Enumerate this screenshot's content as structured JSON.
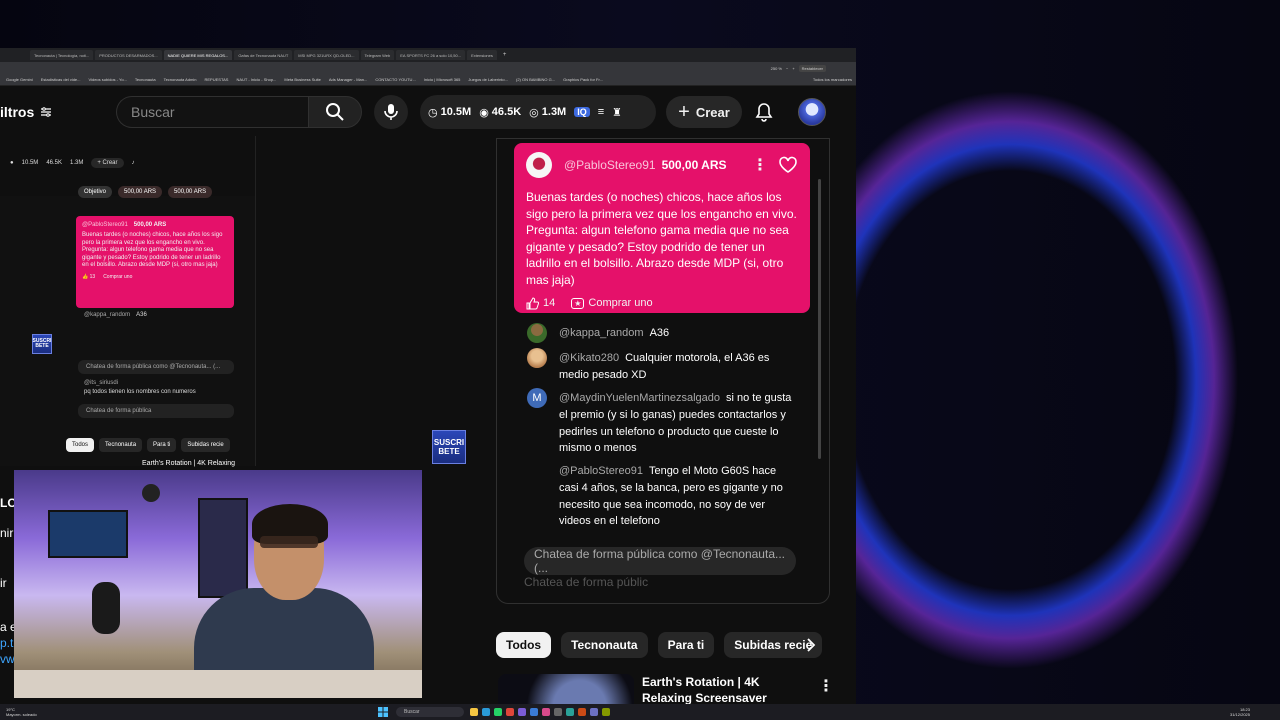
{
  "browser": {
    "tabs": [
      {
        "label": "Tecnonauta | Tecnología, noti..."
      },
      {
        "label": "PRODUCTOS DESARMADOS..."
      },
      {
        "label": "NADIE QUIERE MIS REGALOS..."
      },
      {
        "label": "Gafas de Tecnonauta NAUT"
      },
      {
        "label": "MSI MPG 321URX QD-OLED..."
      },
      {
        "label": "Telegram Web"
      },
      {
        "label": "EA SPORTS FC 26 a solo 10,50..."
      },
      {
        "label": "Extensiones"
      }
    ],
    "active_tab": 2,
    "zoom": "250 %",
    "restore_label": "Restablecer",
    "bookmarks": [
      "Google Gemini",
      "Estadísticas del vide...",
      "Videos subidos - Yo...",
      "Tecnonauta",
      "Tecnonauta Admin",
      "REPUESTAS",
      "NAUT - Inicio - Shop...",
      "Meta Business Suite",
      "Ads Manager - Man...",
      "CONTACTO YOUTU...",
      "Inicio | Microsoft 365",
      "Juegos de Laberinto...",
      "(2) ON BAMBINO G...",
      "Graphics Pack for Fr...",
      "Todos los marcadores"
    ]
  },
  "header": {
    "filters_label": "iltros",
    "search_placeholder": "Buscar",
    "stats": {
      "views": "10.5M",
      "watch": "46.5K",
      "subs": "1.3M"
    },
    "create_label": "Crear"
  },
  "mini": {
    "stats": {
      "views": "10.5M",
      "watch": "46.5K",
      "subs": "1.3M"
    },
    "create_label": "Crear",
    "chips": [
      "Objetivo",
      "500,00 ARS",
      "500,00 ARS"
    ],
    "super": {
      "user": "@PabloStereo91",
      "amount": "500,00 ARS",
      "text": "Buenas tardes (o noches) chicos, hace años los sigo pero la primera vez que los engancho en vivo. Pregunta: algun telefono gama media que no sea gigante y pesado? Estoy podrido de tener un ladrillo en el bolsillo. Abrazo desde MDP (si, otro mas jaja)",
      "likes": "13",
      "buy": "Comprar uno"
    },
    "reply_author": "@kappa_random",
    "reply_text": "A36",
    "input_placeholder": "Chatea de forma pública como @Tecnonauta... (...",
    "extra_author": "@its_siriusdi",
    "extra_text": "pq todos tienen los nombres con numeros",
    "input2_placeholder": "Chatea de forma pública",
    "tabs": [
      "Todos",
      "Tecnonauta",
      "Para ti",
      "Subidas recie"
    ],
    "video_title": "Earth's Rotation | 4K Relaxing"
  },
  "subscribe_badge": "SUSCRI BETE",
  "chat": {
    "super": {
      "user": "@PabloStereo91",
      "amount": "500,00 ARS",
      "text": "Buenas tardes (o noches) chicos, hace años los sigo pero la primera vez que los engancho en vivo. Pregunta: algun telefono gama media que no sea gigante y pesado? Estoy podrido de tener un ladrillo en el bolsillo. Abrazo desde MDP (si, otro mas jaja)",
      "likes": "14",
      "buy": "Comprar uno",
      "color": "#e5116a"
    },
    "messages": [
      {
        "author": "@kappa_random",
        "text": "A36"
      },
      {
        "author": "@Kikato280",
        "text": "Cualquier motorola, el A36 es medio pesado XD"
      },
      {
        "author": "@MaydinYuelenMartinezsalgado",
        "text": "si no te gusta el premio (y si lo ganas) puedes contactarlos y pedirles un telefono o producto que cueste lo mismo o menos",
        "initial": "M"
      },
      {
        "author": "@PabloStereo91",
        "text": "Tengo el Moto G60S hace casi 4 años, se la banca, pero es gigante y no necesito que sea incomodo, no soy de ver videos en el telefono"
      }
    ],
    "input_placeholder": "Chatea de forma pública como @Tecnonauta... (...",
    "ghost_text": "Chatea de forma públic"
  },
  "chips": [
    "Todos",
    "Tecnonauta",
    "Para ti",
    "Subidas recie"
  ],
  "video": {
    "title": "Earth's Rotation | 4K Relaxing Screensaver"
  },
  "left_cut": [
    "LO",
    "nirr",
    "ir",
    "a e",
    "p.t",
    "vw."
  ],
  "taskbar": {
    "weather_temp": "19°C",
    "weather_desc": "Mayorm. soleado",
    "search_placeholder": "Buscar",
    "time": "18:23",
    "date": "31/12/2025"
  }
}
